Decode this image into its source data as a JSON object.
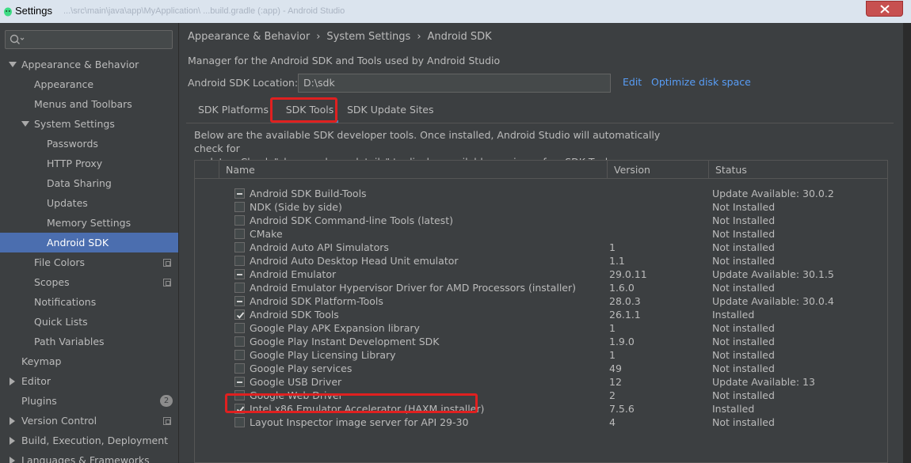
{
  "window": {
    "title": "Settings",
    "background_title": "...\\src\\main\\java\\app\\MyApplication\\  ...build.gradle (:app) - Android Studio"
  },
  "sidebar": {
    "search": {
      "placeholder": ""
    },
    "items": [
      {
        "label": "Appearance & Behavior"
      },
      {
        "label": "Appearance"
      },
      {
        "label": "Menus and Toolbars"
      },
      {
        "label": "System Settings"
      },
      {
        "label": "Passwords"
      },
      {
        "label": "HTTP Proxy"
      },
      {
        "label": "Data Sharing"
      },
      {
        "label": "Updates"
      },
      {
        "label": "Memory Settings"
      },
      {
        "label": "Android SDK"
      },
      {
        "label": "File Colors"
      },
      {
        "label": "Scopes"
      },
      {
        "label": "Notifications"
      },
      {
        "label": "Quick Lists"
      },
      {
        "label": "Path Variables"
      },
      {
        "label": "Keymap"
      },
      {
        "label": "Editor"
      },
      {
        "label": "Plugins",
        "badge": "2"
      },
      {
        "label": "Version Control"
      },
      {
        "label": "Build, Execution, Deployment"
      },
      {
        "label": "Languages & Frameworks"
      }
    ]
  },
  "breadcrumb": [
    "Appearance & Behavior",
    "System Settings",
    "Android SDK"
  ],
  "main": {
    "description": "Manager for the Android SDK and Tools used by Android Studio",
    "location_label": "Android SDK Location:",
    "location_value": "D:\\sdk",
    "edit_link": "Edit",
    "optimize_link": "Optimize disk space",
    "tabs": [
      {
        "label": "SDK Platforms"
      },
      {
        "label": "SDK Tools"
      },
      {
        "label": "SDK Update Sites"
      }
    ],
    "tab_description_1": "Below are the available SDK developer tools. Once installed, Android Studio will automatically check for",
    "tab_description_2": "updates. Check \"show package details\" to display available versions of an SDK Tool."
  },
  "table": {
    "columns": [
      "Name",
      "Version",
      "Status"
    ],
    "rows": [
      {
        "check": "partial",
        "name": "Android SDK Build-Tools",
        "version": "",
        "status": "Update Available: 30.0.2"
      },
      {
        "check": "none",
        "name": "NDK (Side by side)",
        "version": "",
        "status": "Not Installed"
      },
      {
        "check": "none",
        "name": "Android SDK Command-line Tools (latest)",
        "version": "",
        "status": "Not Installed"
      },
      {
        "check": "none",
        "name": "CMake",
        "version": "",
        "status": "Not Installed"
      },
      {
        "check": "none",
        "name": "Android Auto API Simulators",
        "version": "1",
        "status": "Not installed"
      },
      {
        "check": "none",
        "name": "Android Auto Desktop Head Unit emulator",
        "version": "1.1",
        "status": "Not installed"
      },
      {
        "check": "partial",
        "name": "Android Emulator",
        "version": "29.0.11",
        "status": "Update Available: 30.1.5"
      },
      {
        "check": "none",
        "name": "Android Emulator Hypervisor Driver for AMD Processors (installer)",
        "version": "1.6.0",
        "status": "Not installed"
      },
      {
        "check": "partial",
        "name": "Android SDK Platform-Tools",
        "version": "28.0.3",
        "status": "Update Available: 30.0.4"
      },
      {
        "check": "checked",
        "name": "Android SDK Tools",
        "version": "26.1.1",
        "status": "Installed"
      },
      {
        "check": "none",
        "name": "Google Play APK Expansion library",
        "version": "1",
        "status": "Not installed"
      },
      {
        "check": "none",
        "name": "Google Play Instant Development SDK",
        "version": "1.9.0",
        "status": "Not installed"
      },
      {
        "check": "none",
        "name": "Google Play Licensing Library",
        "version": "1",
        "status": "Not installed"
      },
      {
        "check": "none",
        "name": "Google Play services",
        "version": "49",
        "status": "Not installed"
      },
      {
        "check": "partial",
        "name": "Google USB Driver",
        "version": "12",
        "status": "Update Available: 13"
      },
      {
        "check": "none",
        "name": "Google Web Driver",
        "version": "2",
        "status": "Not installed"
      },
      {
        "check": "checked",
        "name": "Intel x86 Emulator Accelerator (HAXM installer)",
        "version": "7.5.6",
        "status": "Installed"
      },
      {
        "check": "none",
        "name": "Layout Inspector image server for API 29-30",
        "version": "4",
        "status": "Not installed"
      }
    ]
  },
  "colors": {
    "background": "#3c3f41",
    "selection": "#4b6eaf",
    "link": "#589df6",
    "highlight_box": "#e02020",
    "tab_underline": "#4a88c7"
  }
}
